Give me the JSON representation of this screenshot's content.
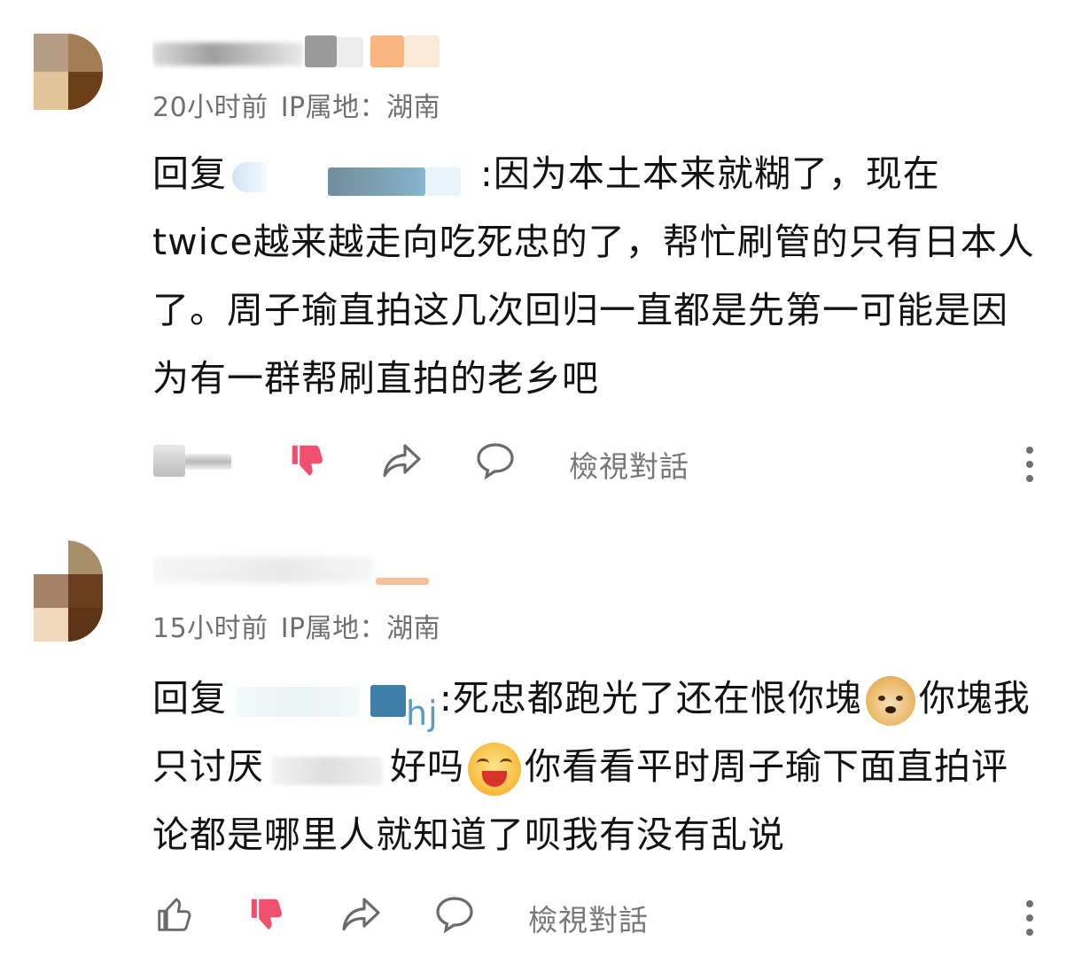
{
  "comments": [
    {
      "time": "20小时前",
      "ip_label": "IP属地：湖南",
      "reply_prefix": "回复",
      "reply_text": ":因为本土本来就糊了，现在twice越来越走向吃死忠的了，帮忙刷管的只有日本人了。周子瑜直拍这几次回归一直都是先第一可能是因为有一群帮刷直拍的老乡吧",
      "like_count_obscured": true,
      "view_thread_label": "檢視對話"
    },
    {
      "time": "15小时前",
      "ip_label": "IP属地：湖南",
      "reply_prefix": "回复",
      "mention_suffix": "hj",
      "reply_text_a": ":死忠都跑光了还在恨你塊",
      "reply_text_b": "你塊我只讨厌",
      "reply_text_c": "好吗",
      "reply_text_d": "你看看平时周子瑜下面直拍评论都是哪里人就知道了呗我有没有乱说",
      "view_thread_label": "檢視對話"
    }
  ],
  "icons": {
    "like": "thumbs-up-icon",
    "dislike": "thumbs-down-icon",
    "share": "share-arrow-icon",
    "reply": "speech-bubble-icon",
    "more": "more-vertical-icon"
  },
  "colors": {
    "dislike_active": "#f0506e",
    "meta_text": "#6f6f6f",
    "action_icon": "#6a6a6a"
  }
}
